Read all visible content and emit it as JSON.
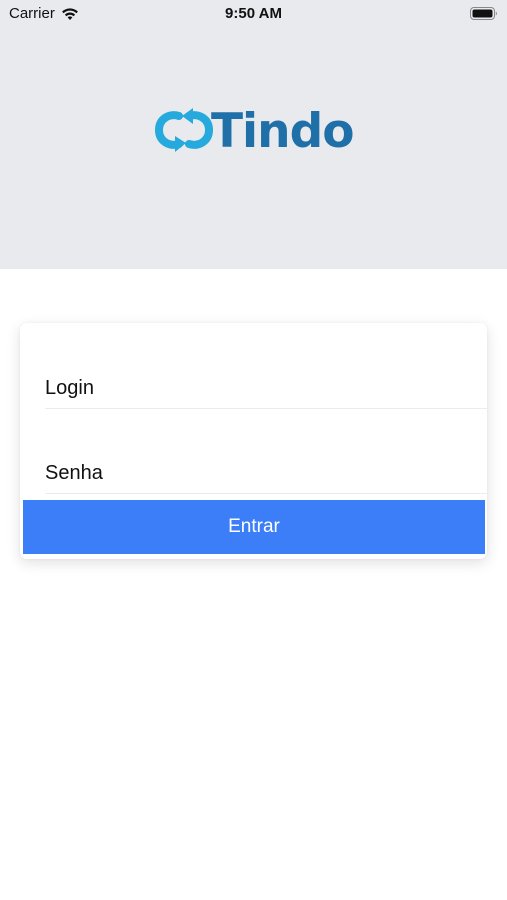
{
  "status_bar": {
    "carrier": "Carrier",
    "time": "9:50 AM",
    "wifi_icon": "wifi-icon",
    "battery_icon": "battery-icon"
  },
  "logo": {
    "text": "Tindo",
    "mark_icon": "refresh-cycle-icon",
    "colors": {
      "mark": "#26a9dc",
      "text": "#1f6fa8"
    }
  },
  "login_form": {
    "login": {
      "placeholder": "Login",
      "value": ""
    },
    "password": {
      "placeholder": "Senha",
      "value": ""
    },
    "submit_label": "Entrar"
  },
  "colors": {
    "header_bg": "#e9eaee",
    "accent": "#3b7ef8",
    "background": "#ffffff"
  }
}
